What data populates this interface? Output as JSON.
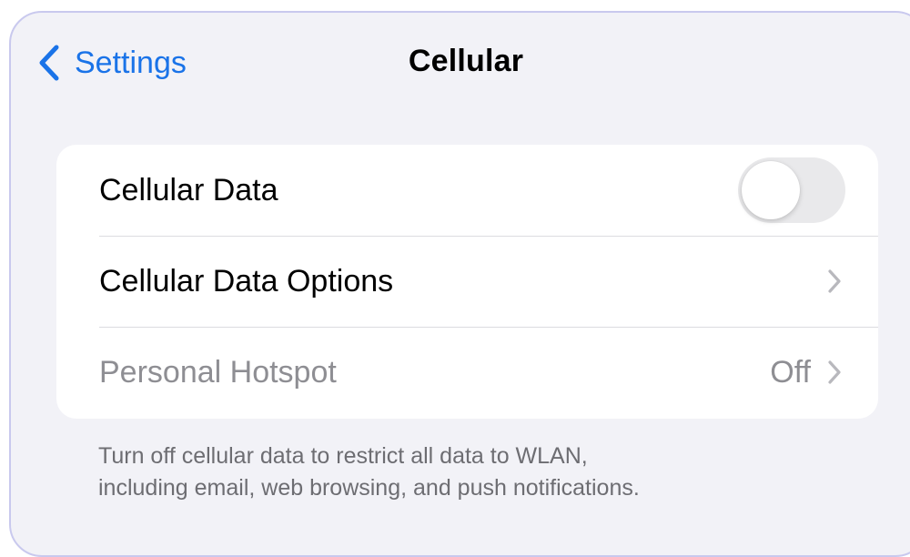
{
  "nav": {
    "back_label": "Settings",
    "title": "Cellular"
  },
  "rows": [
    {
      "label": "Cellular Data",
      "control": "toggle",
      "toggle_on": false
    },
    {
      "label": "Cellular Data Options",
      "control": "chevron"
    },
    {
      "label": "Personal Hotspot",
      "value": "Off",
      "control": "chevron",
      "disabled": true
    }
  ],
  "footer": {
    "note_line1": "Turn off cellular data to restrict all data to WLAN,",
    "note_line2": "including email, web browsing, and push notifications."
  },
  "colors": {
    "accent": "#1a73e8",
    "background": "#f2f2f7",
    "toggle_off": "#e9e9eb",
    "secondary_text": "#8e8e93"
  },
  "icons": {
    "back": "chevron-left-icon",
    "disclosure": "chevron-right-icon"
  }
}
